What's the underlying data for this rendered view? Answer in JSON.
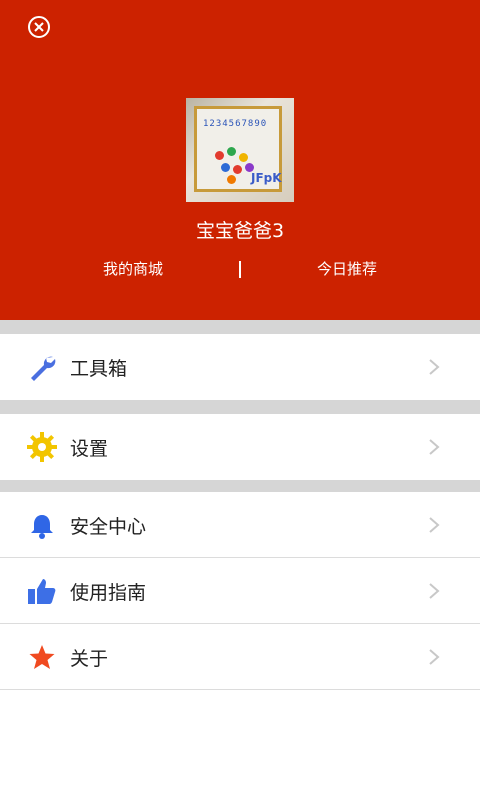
{
  "profile": {
    "name": "宝宝爸爸3",
    "links": {
      "mall": "我的商城",
      "separator": "|",
      "recommend": "今日推荐"
    }
  },
  "menu": {
    "toolbox": "工具箱",
    "settings": "设置",
    "security": "安全中心",
    "guide": "使用指南",
    "about": "关于"
  },
  "colors": {
    "header": "#cc2200",
    "gap": "#d6d6d6",
    "wrench": "#4a6fe0",
    "gear": "#f2c500",
    "bell": "#2f66e6",
    "thumb": "#3d6fe6",
    "star": "#f04a20"
  },
  "icons": {
    "close": "close-circle-icon",
    "toolbox": "wrench-icon",
    "settings": "gear-icon",
    "security": "bell-icon",
    "guide": "thumbs-up-icon",
    "about": "star-icon"
  }
}
